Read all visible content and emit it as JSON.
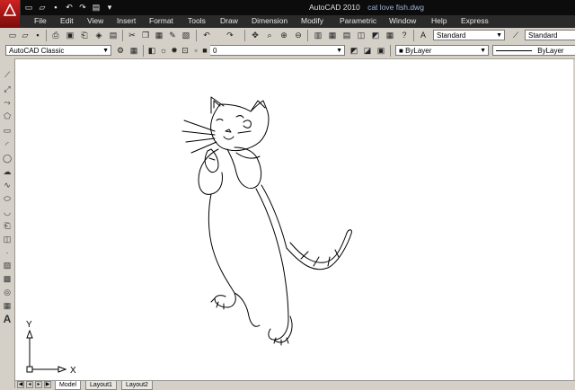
{
  "window": {
    "app_title": "AutoCAD 2010",
    "file_name": "cat love fish.dwg"
  },
  "menu": [
    "File",
    "Edit",
    "View",
    "Insert",
    "Format",
    "Tools",
    "Draw",
    "Dimension",
    "Modify",
    "Parametric",
    "Window",
    "Help",
    "Express"
  ],
  "toolbar1": {
    "text_style": "Standard",
    "dim_style": "Standard"
  },
  "toolbar2": {
    "workspace": "AutoCAD Classic",
    "layer": "0",
    "color": "ByLayer",
    "linetype": "ByLayer"
  },
  "ucs": {
    "y_label": "Y",
    "x_label": "X"
  },
  "tabs": {
    "model": "Model",
    "layout1": "Layout1",
    "layout2": "Layout2"
  },
  "colors": {
    "title_bg": "#0c0c0c",
    "menu_bg": "#2a2a2a",
    "toolbar_bg": "#d4d0c8",
    "canvas_bg": "#ffffff",
    "logo_red": "#c22222"
  }
}
